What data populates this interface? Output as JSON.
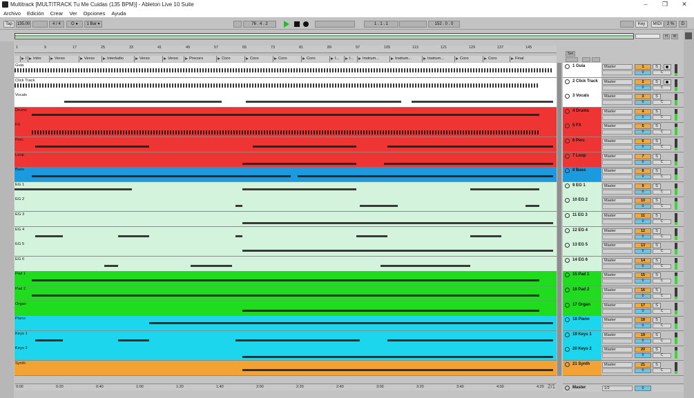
{
  "window": {
    "title": "Multitrack  [MULTITRACK Tu Me Cuidas (135 BPM)] - Ableton Live 10 Suite",
    "controls": [
      "–",
      "❐",
      "✕"
    ]
  },
  "menu": [
    "Archivo",
    "Edición",
    "Crear",
    "Ver",
    "Opciones",
    "Ayuda"
  ],
  "control_bar": {
    "tap": "Tap",
    "tempo": "135.00",
    "signature": "4 / 4",
    "metro": "O ●",
    "quantize": "1 Bar ▾",
    "position": "76 .  4 .  2",
    "loop_start": "1 .  1 .  1",
    "loop_length": "152 .  0 .  0",
    "key": "Key",
    "midi": "MIDI",
    "cpu": "2 %",
    "d": "D"
  },
  "overview_labels": [
    "H",
    "W"
  ],
  "ruler_bars": [
    "1",
    "9",
    "17",
    "25",
    "33",
    "41",
    "49",
    "57",
    "65",
    "73",
    "81",
    "89",
    "97",
    "105",
    "113",
    "121",
    "129",
    "137",
    "145"
  ],
  "locators": [
    "I...",
    "Intro",
    "Verso",
    "Verso",
    "Interludio",
    "Verso",
    "Verso",
    "Precoro",
    "Coro",
    "Coro",
    "Coro",
    "Coro",
    "I...",
    "I...",
    "Instrum...",
    "Instrum...",
    "Instrum...",
    "Coro",
    "Coro",
    "Final"
  ],
  "tracks": [
    {
      "arr_name": "Guia",
      "name": "1 Guia",
      "num": "1",
      "color": "#ffffff",
      "head": "#ffffff",
      "arm": true,
      "clips": "guia"
    },
    {
      "arr_name": "Click Track",
      "name": "2 Click Track",
      "num": "2",
      "color": "#ffffff",
      "head": "#ffffff",
      "arm": true,
      "clips": "click"
    },
    {
      "arr_name": "Vocals",
      "name": "3 Vocals",
      "num": "3",
      "color": "#ffffff",
      "head": "#ffffff",
      "arm": false,
      "clips": "vocals"
    },
    {
      "arr_name": "Drums",
      "name": "4 Drums",
      "num": "4",
      "color": "#ef3434",
      "head": "#ef3434",
      "arm": false,
      "clips": "drums"
    },
    {
      "arr_name": "FX",
      "name": "5 FX",
      "num": "5",
      "color": "#ef3434",
      "head": "#ef3434",
      "arm": false,
      "clips": "fx"
    },
    {
      "arr_name": "Perc",
      "name": "6 Perc",
      "num": "6",
      "color": "#ef3434",
      "head": "#ef3434",
      "arm": false,
      "clips": "perc"
    },
    {
      "arr_name": "Loop",
      "name": "7 Loop",
      "num": "7",
      "color": "#ef3434",
      "head": "#ef3434",
      "arm": false,
      "clips": "loop"
    },
    {
      "arr_name": "Bass",
      "name": "8 Bass",
      "num": "8",
      "color": "#1c9ae0",
      "head": "#1c9ae0",
      "arm": false,
      "clips": "bass"
    },
    {
      "arr_name": "EG 1",
      "name": "9 EG 1",
      "num": "9",
      "color": "#d3f3dc",
      "head": "#d3f3dc",
      "arm": false,
      "clips": "eg1"
    },
    {
      "arr_name": "EG 2",
      "name": "10 EG 2",
      "num": "10",
      "color": "#d3f3dc",
      "head": "#d3f3dc",
      "arm": false,
      "clips": "eg2"
    },
    {
      "arr_name": "EG 3",
      "name": "11 EG 3",
      "num": "11",
      "color": "#d3f3dc",
      "head": "#d3f3dc",
      "arm": false,
      "clips": "eg3"
    },
    {
      "arr_name": "EG 4",
      "name": "12 EG 4",
      "num": "12",
      "color": "#d3f3dc",
      "head": "#d3f3dc",
      "arm": false,
      "clips": "eg4"
    },
    {
      "arr_name": "EG 5",
      "name": "13 EG 5",
      "num": "13",
      "color": "#d3f3dc",
      "head": "#d3f3dc",
      "arm": false,
      "clips": "eg5"
    },
    {
      "arr_name": "EG 6",
      "name": "14 EG 6",
      "num": "14",
      "color": "#d3f3dc",
      "head": "#d3f3dc",
      "arm": false,
      "clips": "eg6"
    },
    {
      "arr_name": "Pad 1",
      "name": "15 Pad 1",
      "num": "15",
      "color": "#1fdc1f",
      "head": "#1fdc1f",
      "arm": false,
      "clips": "pad1"
    },
    {
      "arr_name": "Pad 2",
      "name": "16 Pad 2",
      "num": "16",
      "color": "#1fdc1f",
      "head": "#1fdc1f",
      "arm": false,
      "clips": "pad2"
    },
    {
      "arr_name": "Organ",
      "name": "17 Organ",
      "num": "17",
      "color": "#1fdc1f",
      "head": "#1fdc1f",
      "arm": false,
      "clips": "organ"
    },
    {
      "arr_name": "Piano",
      "name": "18 Piano",
      "num": "18",
      "color": "#1cd6ee",
      "head": "#1cd6ee",
      "arm": false,
      "clips": "piano"
    },
    {
      "arr_name": "Keys 1",
      "name": "19 Keys 1",
      "num": "19",
      "color": "#1cd6ee",
      "head": "#1cd6ee",
      "arm": false,
      "clips": "keys1"
    },
    {
      "arr_name": "Keys 2",
      "name": "20 Keys 2",
      "num": "20",
      "color": "#1cd6ee",
      "head": "#1cd6ee",
      "arm": false,
      "clips": "keys2"
    },
    {
      "arr_name": "Synth",
      "name": "21 Synth",
      "num": "21",
      "color": "#f3a234",
      "head": "#f3a234",
      "arm": false,
      "clips": "synth"
    }
  ],
  "mixer": {
    "output": "Master",
    "zero": "0",
    "solo": "S",
    "cue": "C"
  },
  "set_label": "Set",
  "page_indicator": "2/1",
  "time_ruler": [
    "0:00",
    "0:20",
    "0:40",
    "1:00",
    "1:20",
    "1:40",
    "2:00",
    "2:20",
    "2:40",
    "3:00",
    "3:20",
    "3:40",
    "4:00",
    "4:20"
  ],
  "master_row": {
    "name": "Master",
    "routing": "1/2",
    "zero": "0"
  }
}
